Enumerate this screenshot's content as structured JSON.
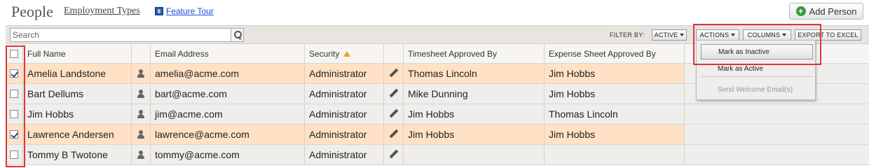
{
  "header": {
    "title": "People",
    "employment_types": "Employment Types",
    "feature_tour": "Feature Tour",
    "add_person": "Add Person"
  },
  "toolbar": {
    "search_placeholder": "Search",
    "filter_by": "FILTER BY:",
    "active": "ACTIVE",
    "actions": "ACTIONS",
    "columns": "COLUMNS",
    "export": "EXPORT TO EXCEL"
  },
  "table": {
    "columns": {
      "name": "Full Name",
      "email": "Email Address",
      "security": "Security",
      "timesheet": "Timesheet Approved By",
      "expense": "Expense Sheet Approved By"
    },
    "rows": [
      {
        "name": "Amelia Landstone",
        "email": "amelia@acme.com",
        "security": "Administrator",
        "timesheet": "Thomas Lincoln",
        "expense": "Jim Hobbs",
        "checked": true
      },
      {
        "name": "Bart Dellums",
        "email": "bart@acme.com",
        "security": "Administrator",
        "timesheet": "Mike Dunning",
        "expense": "Jim Hobbs",
        "checked": false
      },
      {
        "name": "Jim Hobbs",
        "email": "jim@acme.com",
        "security": "Administrator",
        "timesheet": "Jim Hobbs",
        "expense": "Thomas Lincoln",
        "checked": false
      },
      {
        "name": "Lawrence Andersen",
        "email": "lawrence@acme.com",
        "security": "Administrator",
        "timesheet": "Jim Hobbs",
        "expense": "Jim Hobbs",
        "checked": true
      },
      {
        "name": "Tommy B Twotone",
        "email": "tommy@acme.com",
        "security": "Administrator",
        "timesheet": "",
        "expense": "",
        "checked": false
      }
    ]
  },
  "actions_menu": {
    "mark_inactive": "Mark as Inactive",
    "mark_active": "Mark as Active",
    "send_welcome": "Send Welcome Email(s)"
  },
  "colors": {
    "selected_row": "#ffe2c5",
    "highlight_box": "#d9363e",
    "sort_arrow": "#f0a020"
  }
}
